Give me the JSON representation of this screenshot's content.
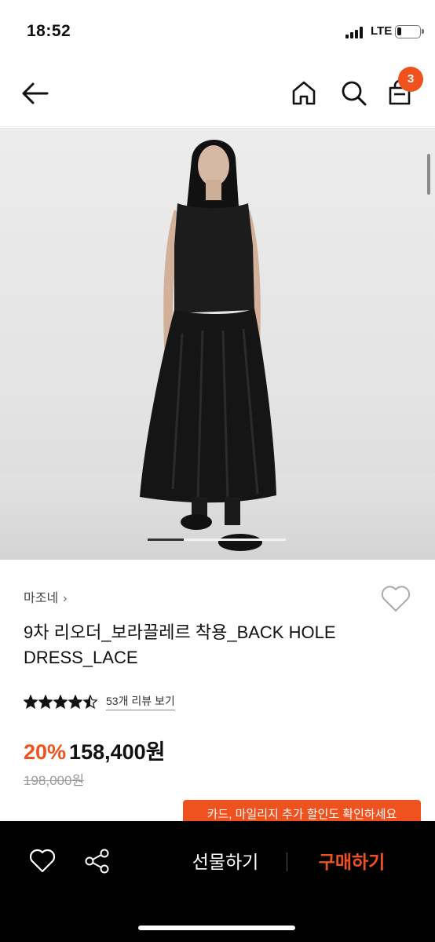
{
  "status_bar": {
    "time": "18:52",
    "network": "LTE",
    "icons": [
      "signal-icon",
      "battery-icon"
    ]
  },
  "nav": {
    "icons": [
      "back-arrow-icon",
      "home-icon",
      "search-icon",
      "cart-icon"
    ],
    "cart_badge": "3"
  },
  "product": {
    "brand": "마조네",
    "brand_chevron": "›",
    "title": "9차 리오더_보라끌레르 착용_BACK HOLE DRESS_LACE",
    "rating": 4.5,
    "review_link": "53개 리뷰 보기",
    "discount": "20%",
    "price": "158,400원",
    "original_price": "198,000원",
    "image_slide_position": "1"
  },
  "promo": {
    "banner_text": "카드, 마일리지 추가 할인도 확인하세요"
  },
  "bottom_bar": {
    "icons": [
      "heart-icon",
      "share-icon"
    ],
    "gift_label": "선물하기",
    "buy_label": "구매하기"
  },
  "colors": {
    "accent": "#f0521f",
    "bottom_bar": "#000000",
    "text": "#111111"
  }
}
